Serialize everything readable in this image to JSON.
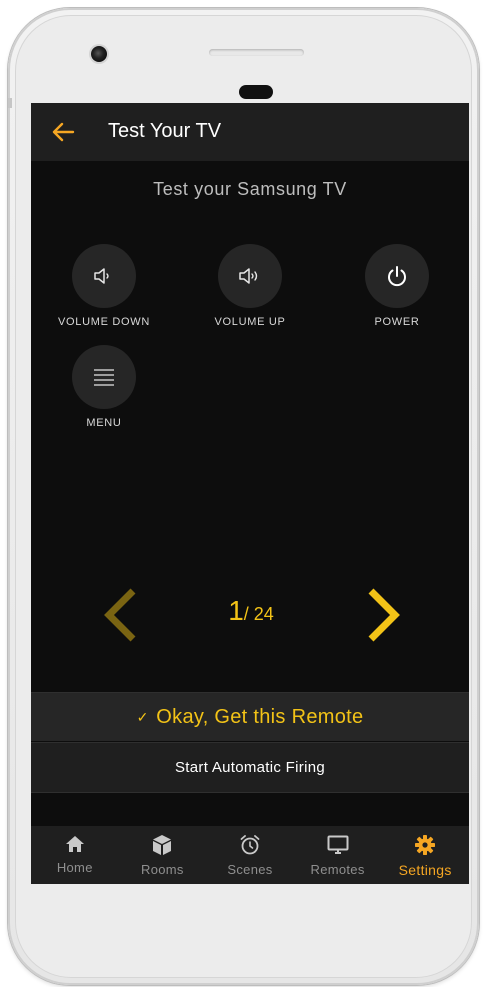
{
  "app_bar": {
    "title": "Test Your TV"
  },
  "subtitle": "Test your Samsung TV",
  "buttons": [
    {
      "label": "VOLUME DOWN",
      "icon": "volume-down-icon"
    },
    {
      "label": "VOLUME UP",
      "icon": "volume-up-icon"
    },
    {
      "label": "POWER",
      "icon": "power-icon"
    },
    {
      "label": "MENU",
      "icon": "menu-icon"
    }
  ],
  "pager": {
    "current": "1",
    "total": "/ 24"
  },
  "actions": {
    "confirm_check": "✓",
    "confirm_label": "Okay, Get this Remote",
    "auto_label": "Start Automatic Firing"
  },
  "tabs": [
    {
      "label": "Home",
      "icon": "home-icon",
      "active": false
    },
    {
      "label": "Rooms",
      "icon": "cube-icon",
      "active": false
    },
    {
      "label": "Scenes",
      "icon": "alarm-clock-icon",
      "active": false
    },
    {
      "label": "Remotes",
      "icon": "monitor-icon",
      "active": false
    },
    {
      "label": "Settings",
      "icon": "gear-icon",
      "active": true
    }
  ],
  "colors": {
    "accent_yellow": "#f3c317",
    "accent_orange": "#f5a623",
    "screen_bg": "#0d0d0d",
    "bar_bg": "#1f1f1f",
    "button_bg": "#262626"
  }
}
